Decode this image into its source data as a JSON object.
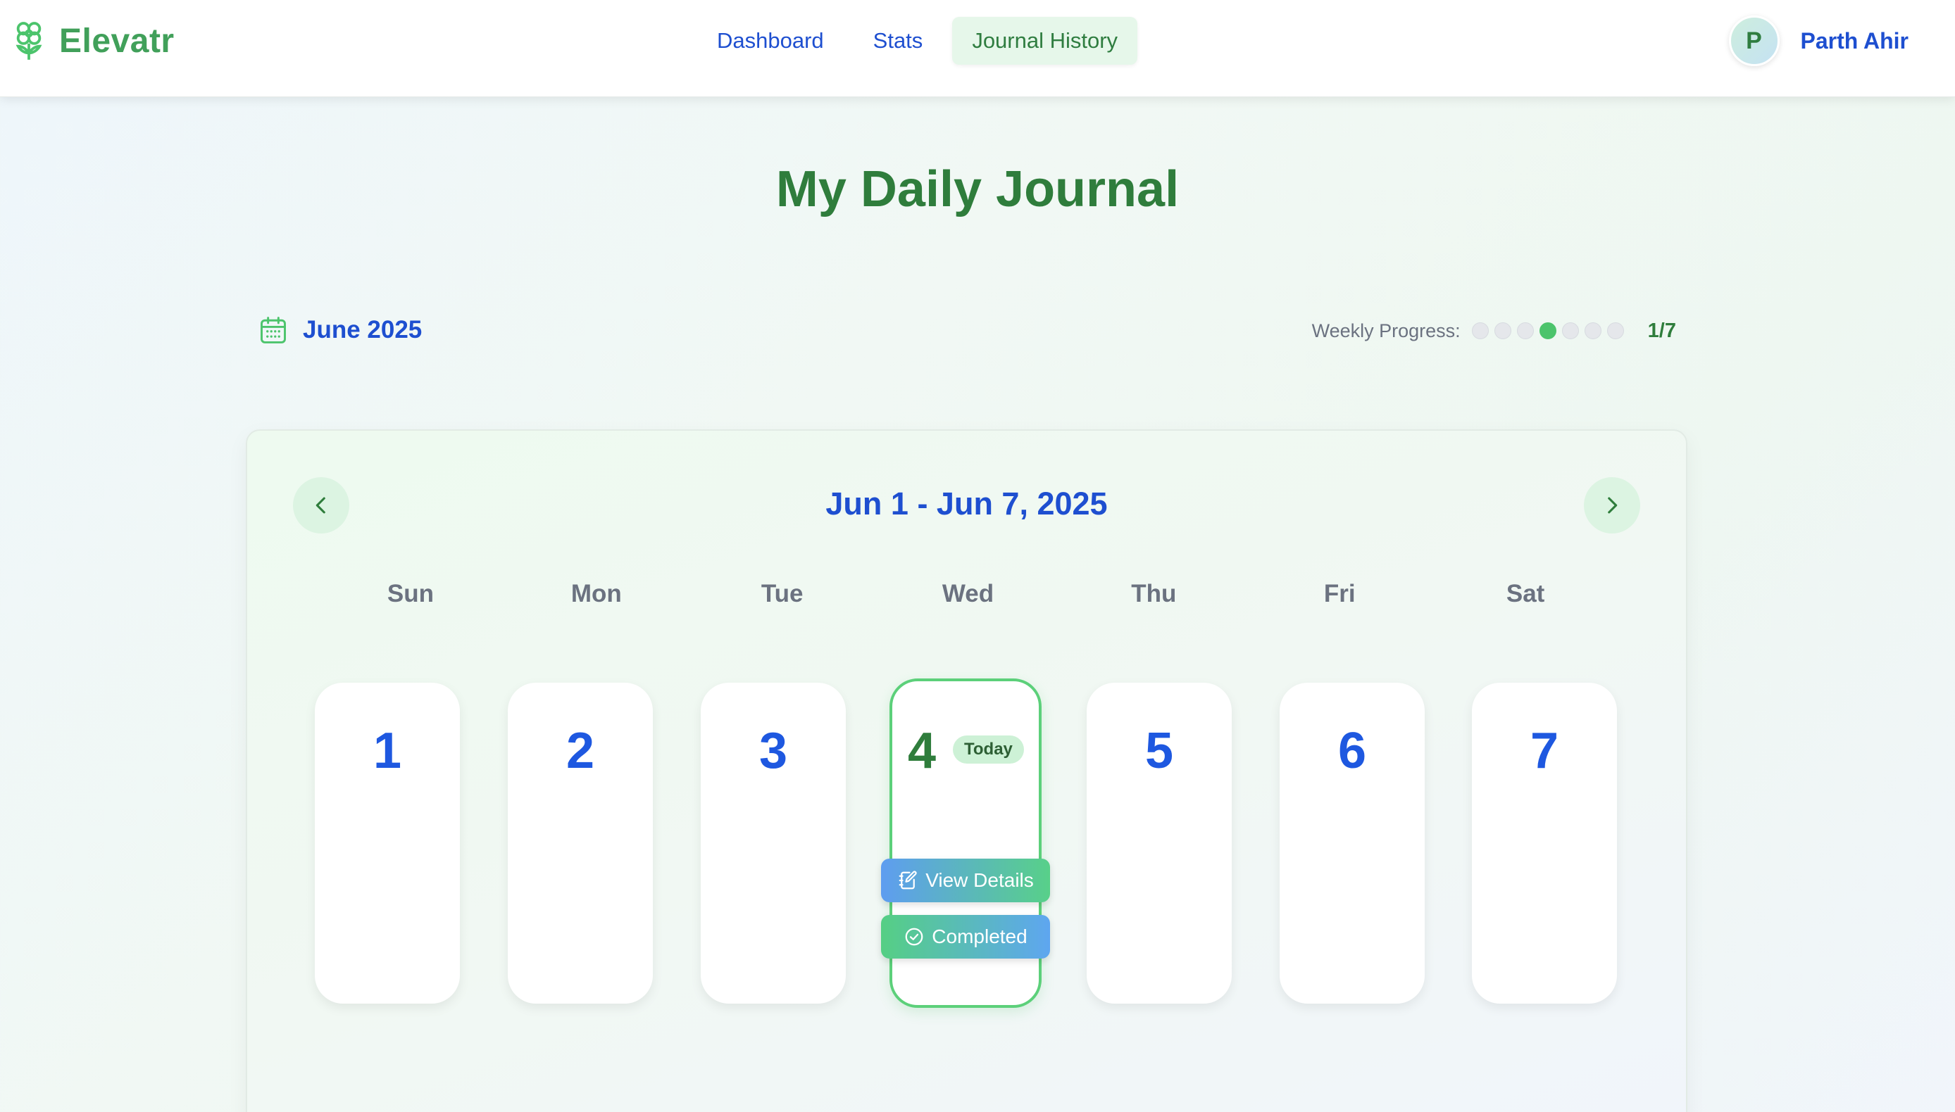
{
  "app": {
    "name": "Elevatr",
    "logo_icon": "flower-icon"
  },
  "nav": {
    "links": [
      {
        "label": "Dashboard",
        "active": false
      },
      {
        "label": "Stats",
        "active": false
      },
      {
        "label": "Journal History",
        "active": true
      }
    ]
  },
  "user": {
    "initial": "P",
    "name": "Parth Ahir"
  },
  "page": {
    "title": "My Daily Journal"
  },
  "month": {
    "label": "June 2025",
    "icon": "calendar-icon"
  },
  "progress": {
    "label": "Weekly Progress:",
    "completed_days": [
      4
    ],
    "total_days": 7,
    "count_text": "1/7"
  },
  "calendar": {
    "range": "Jun 1 - Jun 7, 2025",
    "prev_icon": "chevron-left-icon",
    "next_icon": "chevron-right-icon",
    "weekdays": [
      "Sun",
      "Mon",
      "Tue",
      "Wed",
      "Thu",
      "Fri",
      "Sat"
    ],
    "days": [
      "1",
      "2",
      "3",
      "4",
      "5",
      "6",
      "7"
    ],
    "today_badge": "Today",
    "view_details_label": "View Details",
    "completed_label": "Completed"
  },
  "colors": {
    "brand_green": "#41a05a",
    "link_blue": "#1e4fd0",
    "title_green": "#2f7d3c",
    "today_border": "#5cd07a",
    "progress_done": "#4cc46c"
  }
}
